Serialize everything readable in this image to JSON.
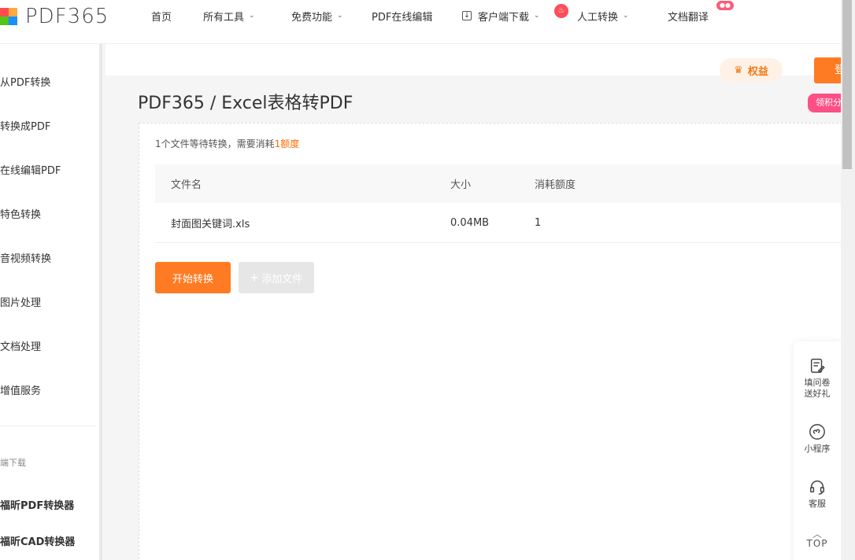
{
  "brand": {
    "name": "PDF365",
    "colors": [
      "#ff4d4f",
      "#ffa940",
      "#52c41a",
      "#1890ff"
    ]
  },
  "nav": {
    "items": [
      {
        "label": "首页",
        "dropdown": false
      },
      {
        "label": "所有工具",
        "dropdown": true
      },
      {
        "label": "免费功能",
        "dropdown": true
      },
      {
        "label": "PDF在线编辑",
        "dropdown": false
      },
      {
        "label": "客户端下载",
        "dropdown": true
      },
      {
        "label": "人工转换",
        "dropdown": true
      },
      {
        "label": "文档翻译",
        "dropdown": false
      }
    ]
  },
  "sidebar": {
    "items": [
      "从PDF转换",
      "转换成PDF",
      "在线编辑PDF",
      "特色转换",
      "音视频转换",
      "图片处理",
      "文档处理",
      "增值服务"
    ],
    "sub_title": "端下载",
    "downloads": [
      "福昕PDF转换器",
      "福昕CAD转换器"
    ]
  },
  "header": {
    "equity_label": "权益",
    "login_label": "登",
    "pink_tag": "领积分"
  },
  "main": {
    "title": "PDF365 / Excel表格转PDF",
    "notice_prefix": "1个文件等待转换，需要消耗",
    "notice_highlight": "1额度",
    "columns": [
      "文件名",
      "大小",
      "消耗额度"
    ],
    "rows": [
      {
        "name": "封面图关键词.xls",
        "size": "0.04MB",
        "cost": "1"
      }
    ],
    "start_label": "开始转换",
    "add_label": "添加文件"
  },
  "float_bar": {
    "survey_line1": "填问卷",
    "survey_line2": "送好礼",
    "miniprogram": "小程序",
    "service": "客服",
    "top": "TOP"
  },
  "colors": {
    "accent": "#ff7b23",
    "highlight": "#ff6a00",
    "pink": "#ff4f86"
  }
}
